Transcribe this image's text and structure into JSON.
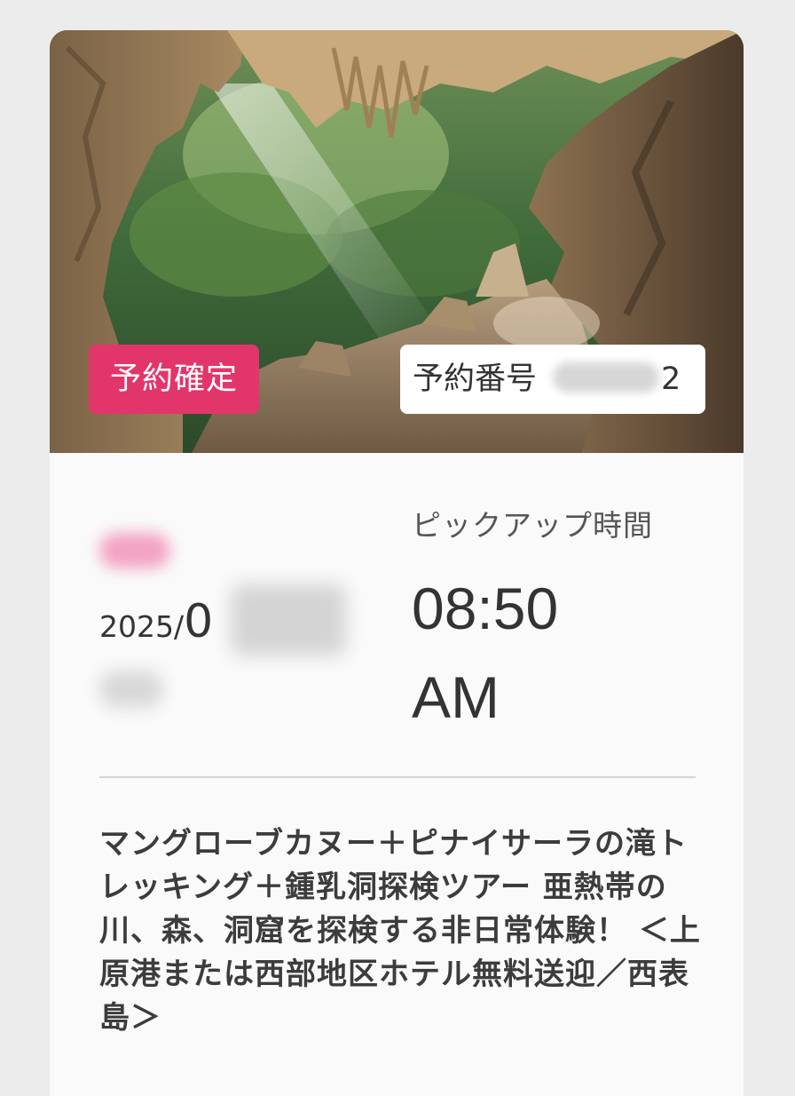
{
  "status_badge": "予約確定",
  "booking": {
    "label": "予約番号",
    "visible_suffix": "2"
  },
  "date": {
    "prefix": "2025/",
    "visible_digit": "0"
  },
  "pickup": {
    "label": "ピックアップ時間",
    "time": "08:50",
    "period": "AM"
  },
  "tour": {
    "title": "マングローブカヌー＋ピナイサーラの滝トレッキング＋鍾乳洞探検ツアー 亜熱帯の川、森、洞窟を探検する非日常体験！ ＜上原港または西部地区ホテル無料送迎／西表島＞"
  },
  "colors": {
    "status_badge_bg": "#e2366a",
    "card_bg": "#fafafa",
    "page_bg": "#ececec",
    "text_primary": "#333333"
  }
}
